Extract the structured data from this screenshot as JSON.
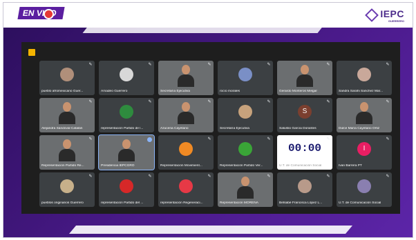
{
  "header": {
    "live_label": "EN VIVO",
    "logo_text": "IEPC",
    "logo_sub": "GUERRERO"
  },
  "colors": {
    "brand_purple": "#4a1a8a",
    "live_red": "#e53935",
    "meet_bg": "#1e1e1e",
    "tile_bg": "#3c4043"
  },
  "participants": [
    {
      "name": "pueblo afromexicano Guer...",
      "kind": "avatar",
      "avatar_color": "#b08f7a"
    },
    {
      "name": "Amadeo Guerrero",
      "kind": "avatar",
      "avatar_color": "#d8d8d8"
    },
    {
      "name": "Secretaría Ejecutiva",
      "kind": "video"
    },
    {
      "name": "rocío morales",
      "kind": "avatar",
      "avatar_color": "#7a8fc6"
    },
    {
      "name": "Gerardo Monteros Melgar",
      "kind": "video"
    },
    {
      "name": "Sandra Sarahi Sanchez Mar...",
      "kind": "avatar",
      "avatar_color": "#c9a89a"
    },
    {
      "name": "Alejandra Sandoval Catalán",
      "kind": "video"
    },
    {
      "name": "representación Partido de l...",
      "kind": "avatar",
      "avatar_color": "#2e8b3e"
    },
    {
      "name": "Azucena Cayetano",
      "kind": "video"
    },
    {
      "name": "Secretaría Ejecutiva",
      "kind": "avatar",
      "avatar_color": "#c7a27c"
    },
    {
      "name": "Salustio García Dorantes",
      "kind": "letter",
      "letter": "S",
      "avatar_color": "#7b3f2f"
    },
    {
      "name": "Dulce María Cayetano Ortiz",
      "kind": "video"
    },
    {
      "name": "Representación Partido Re...",
      "kind": "video"
    },
    {
      "name": "Presidencia IEPCGRO",
      "kind": "video",
      "active": true
    },
    {
      "name": "Representación Movimient...",
      "kind": "avatar",
      "avatar_color": "#f08a24"
    },
    {
      "name": "Representación Partido Ver...",
      "kind": "avatar",
      "avatar_color": "#3aa537"
    },
    {
      "name": "U.T. de Comunicación Social",
      "kind": "clock",
      "clock": "00:00"
    },
    {
      "name": "Ivan Barrera PT",
      "kind": "letter",
      "letter": "I",
      "avatar_color": "#e91e63"
    },
    {
      "name": "pueblos originarios Guerrero",
      "kind": "avatar",
      "avatar_color": "#c7b08a"
    },
    {
      "name": "representación Partido del ...",
      "kind": "avatar",
      "avatar_color": "#d62828"
    },
    {
      "name": "representación Regeneraci...",
      "kind": "avatar",
      "avatar_color": "#e63946"
    },
    {
      "name": "Representación MORENA",
      "kind": "video"
    },
    {
      "name": "Betsabé Francisca López L...",
      "kind": "avatar",
      "avatar_color": "#b89a8a"
    },
    {
      "name": "U.T. de Comunicación Social",
      "kind": "avatar",
      "avatar_color": "#8a7fb0"
    }
  ]
}
